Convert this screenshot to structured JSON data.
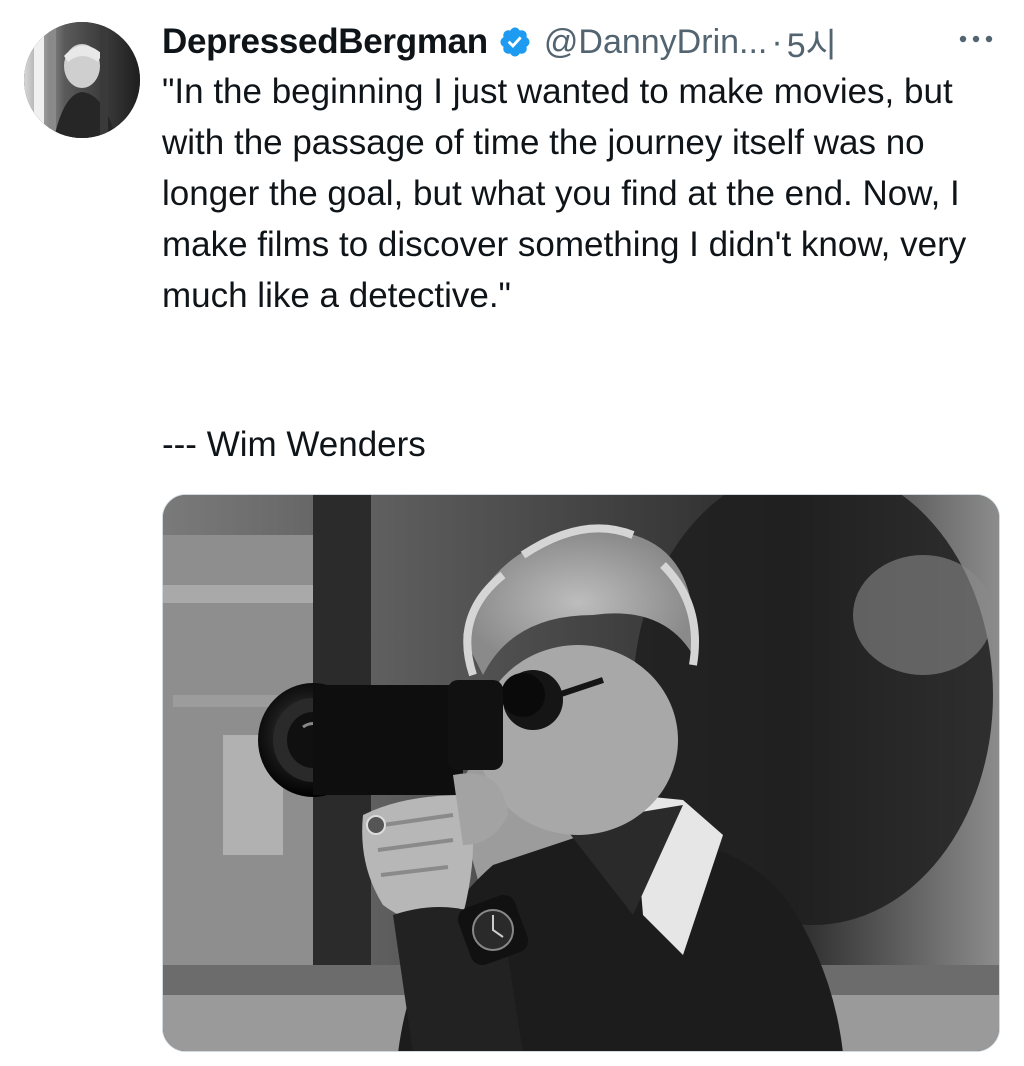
{
  "tweet": {
    "author": {
      "display_name": "DepressedBergman",
      "handle": "@DannyDrin...",
      "verified": true,
      "avatar_icon": "profile-photo"
    },
    "separator": "·",
    "timestamp": "5시",
    "more_icon": "ellipsis-icon",
    "text": "\"In the beginning I just wanted to make movies, but with the passage of time the journey itself was no longer the goal, but what you find at the end. Now, I make films to discover something I didn't know, very much like a detective.\"",
    "attribution": "--- Wim Wenders",
    "media": {
      "type": "photo",
      "style": "black-and-white"
    }
  },
  "colors": {
    "text_primary": "#0f1419",
    "text_secondary": "#536471",
    "verified_blue": "#1d9bf0",
    "background": "#ffffff"
  }
}
